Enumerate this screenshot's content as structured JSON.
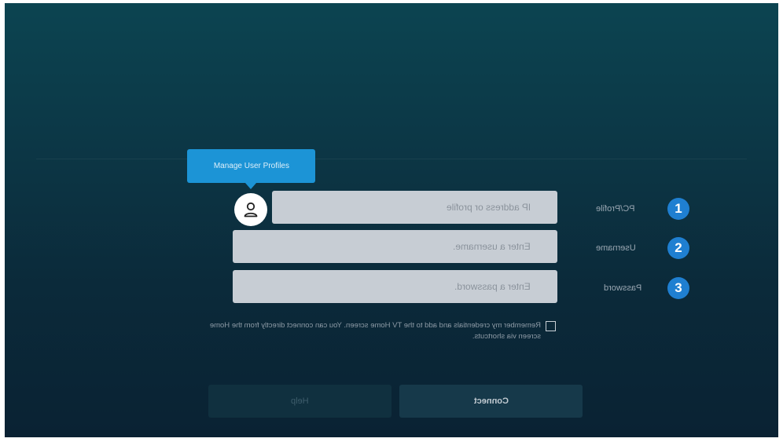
{
  "tooltip": {
    "text": "Manage User Profiles"
  },
  "fields": {
    "profile": {
      "label": "PC/Profile",
      "number": "1",
      "placeholder": "IP address or profile"
    },
    "username": {
      "label": "Username",
      "number": "2",
      "placeholder": "Enter a username."
    },
    "password": {
      "label": "Password",
      "number": "3",
      "placeholder": "Enter a password."
    }
  },
  "remember": {
    "text": "Remember my credentials and add to the TV Home screen. You can connect directly from the Home screen via shortcuts.",
    "checked": false
  },
  "buttons": {
    "help": "Help",
    "connect": "Connect"
  },
  "icons": {
    "avatar": "user-profile-icon"
  },
  "colors": {
    "accent": "#1f7fd1",
    "tooltip": "#1c94d6"
  }
}
